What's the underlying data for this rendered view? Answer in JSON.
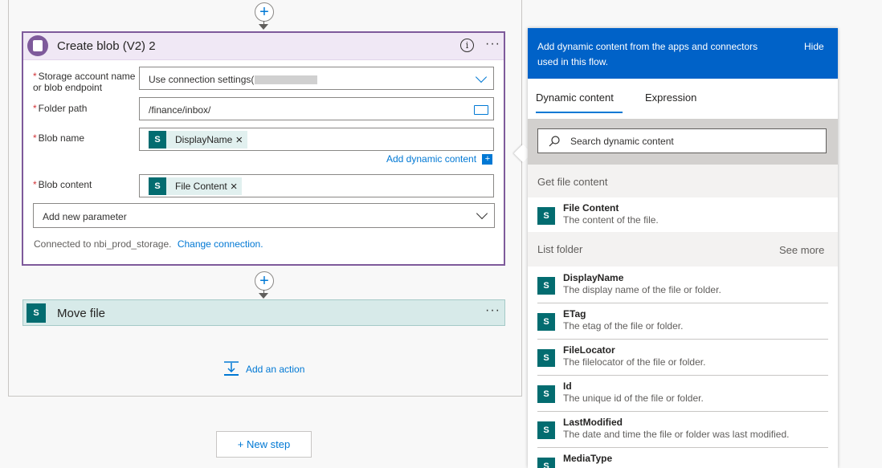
{
  "blob_card": {
    "title": "Create blob (V2) 2",
    "fields": {
      "storage_label": "Storage account name or blob endpoint",
      "storage_value": "Use connection settings(",
      "folder_label": "Folder path",
      "folder_value": "/finance/inbox/",
      "blob_name_label": "Blob name",
      "blob_name_token": "DisplayName",
      "blob_content_label": "Blob content",
      "blob_content_token": "File Content"
    },
    "add_dynamic": "Add dynamic content",
    "add_param": "Add new parameter",
    "connected": "Connected to nbi_prod_storage.",
    "change_connection": "Change connection."
  },
  "move_card": {
    "title": "Move file"
  },
  "add_action": "Add an action",
  "new_step": "+ New step",
  "panel": {
    "header": "Add dynamic content from the apps and connectors used in this flow.",
    "hide": "Hide",
    "tabs": [
      "Dynamic content",
      "Expression"
    ],
    "search_placeholder": "Search dynamic content",
    "groups": [
      {
        "name": "Get file content",
        "items": [
          {
            "name": "File Content",
            "desc": "The content of the file."
          }
        ]
      },
      {
        "name": "List folder",
        "see_more": "See more",
        "items": [
          {
            "name": "DisplayName",
            "desc": "The display name of the file or folder."
          },
          {
            "name": "ETag",
            "desc": "The etag of the file or folder."
          },
          {
            "name": "FileLocator",
            "desc": "The filelocator of the file or folder."
          },
          {
            "name": "Id",
            "desc": "The unique id of the file or folder."
          },
          {
            "name": "LastModified",
            "desc": "The date and time the file or folder was last modified."
          },
          {
            "name": "MediaType",
            "desc": ""
          }
        ]
      }
    ]
  },
  "colors": {
    "accent": "#0078d4",
    "panel_header": "#0062c8",
    "blob_border": "#7e5a9b",
    "sharepoint": "#036c70"
  },
  "icons": [
    "plus-icon",
    "blob-storage-icon",
    "info-icon",
    "more-icon",
    "folder-icon",
    "sharepoint-icon",
    "search-icon",
    "add-action-icon"
  ]
}
